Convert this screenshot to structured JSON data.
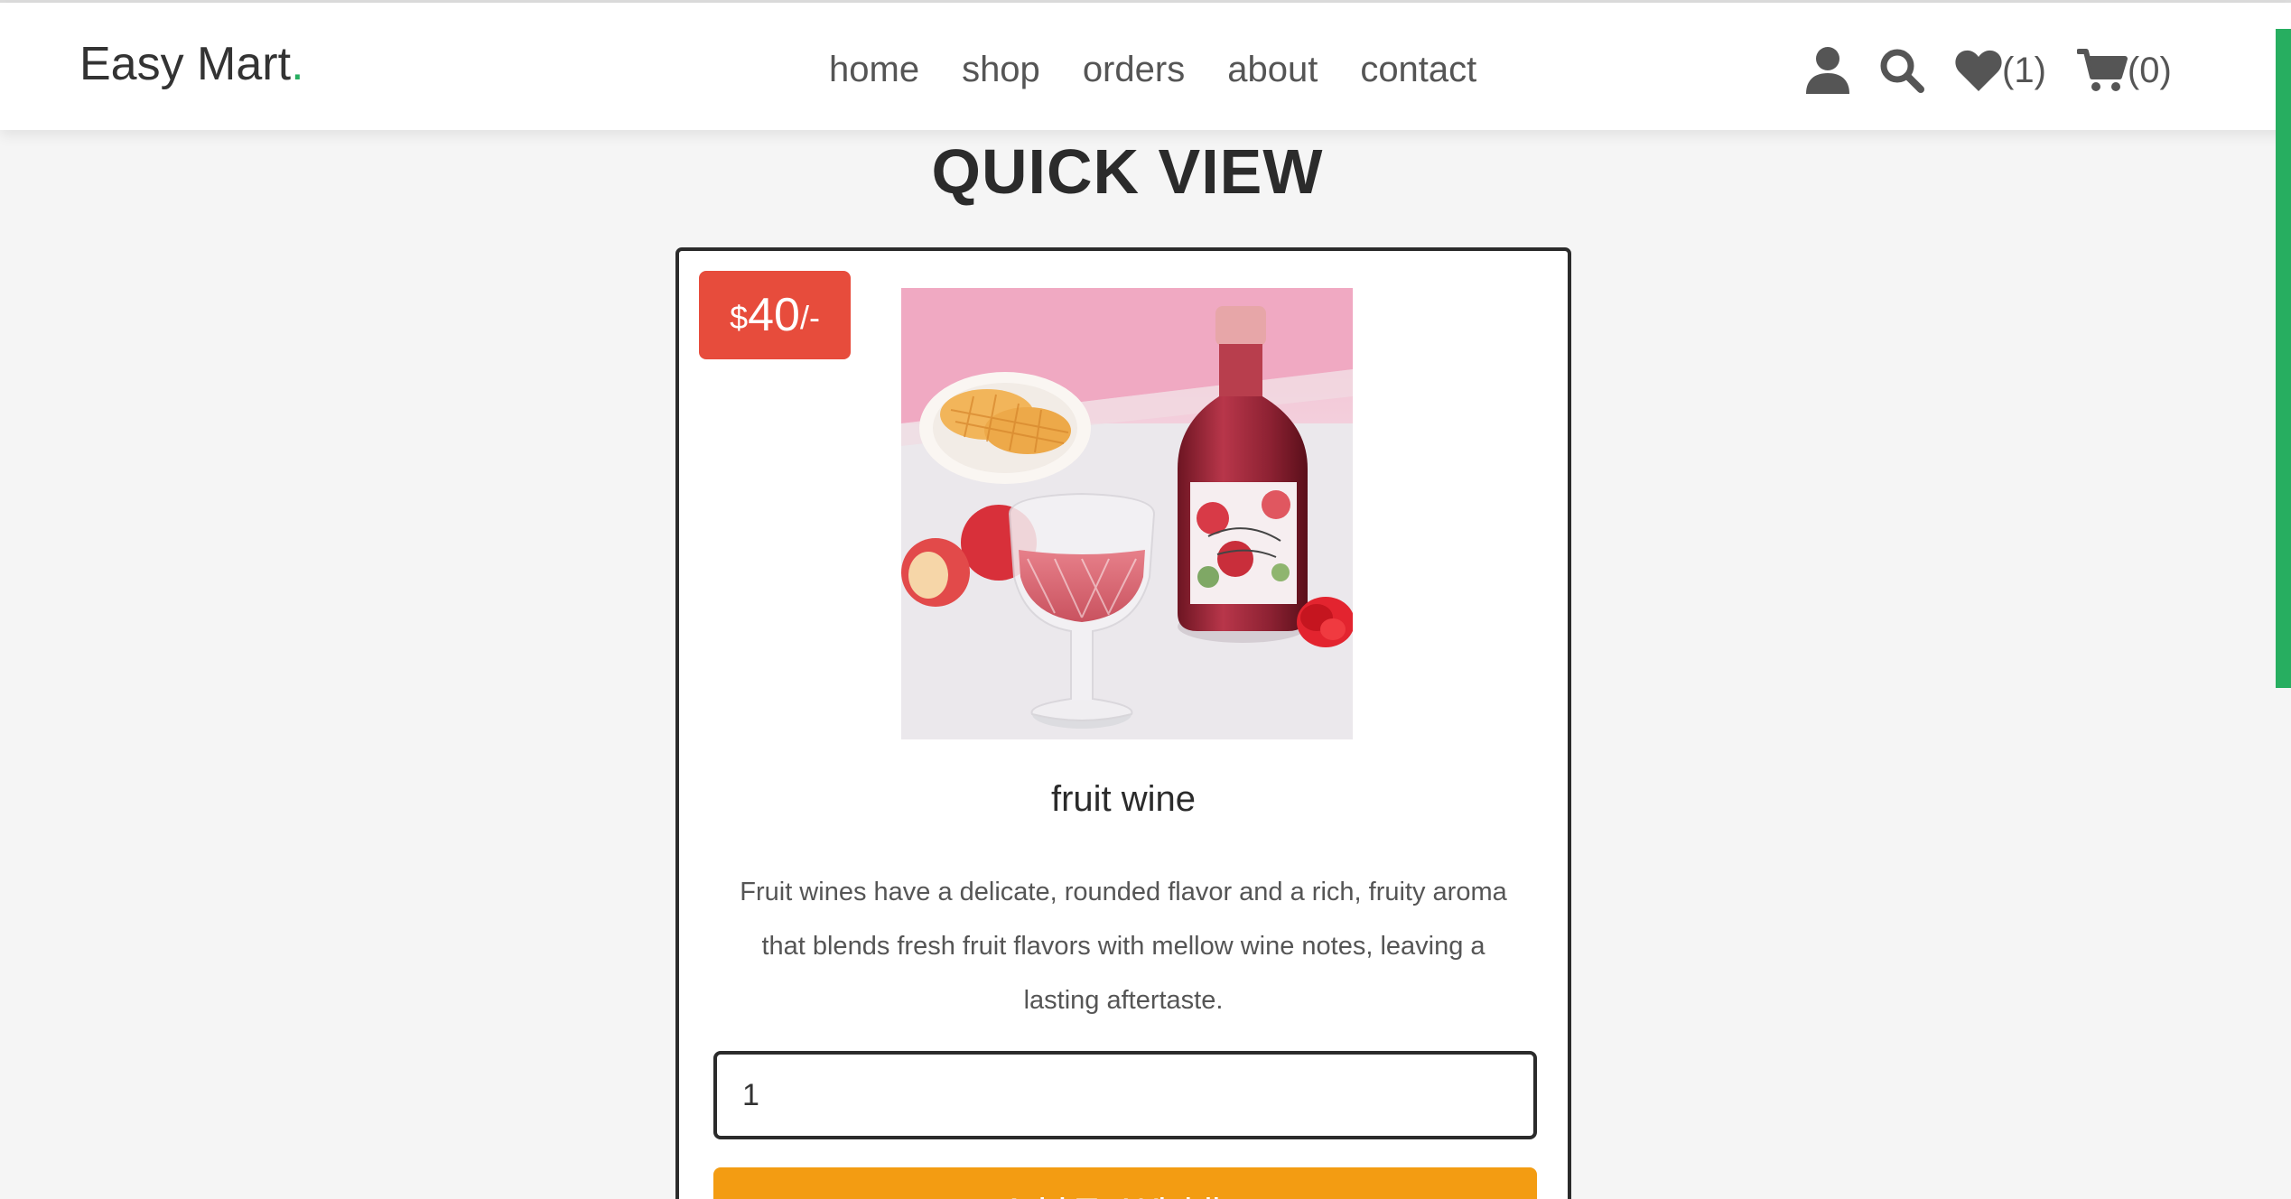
{
  "header": {
    "logo_text": "Easy Mart",
    "logo_dot": ".",
    "nav": [
      "home",
      "shop",
      "orders",
      "about",
      "contact"
    ],
    "wishlist_count": "(1)",
    "cart_count": "(0)"
  },
  "section": {
    "title": "QUICK VIEW"
  },
  "product": {
    "price_currency": "$",
    "price_amount": "40",
    "price_suffix": "/-",
    "name": "fruit wine",
    "description": "Fruit wines have a delicate, rounded flavor and a rich, fruity aroma that blends fresh fruit flavors with mellow wine notes, leaving a lasting aftertaste.",
    "quantity": "1",
    "add_button_label": "Add To Wishlist"
  },
  "colors": {
    "accent": "#27ae60",
    "price_badge": "#e74c3c",
    "button": "#f39c12",
    "text_dark": "#2b2b2b"
  },
  "icons": [
    "user-icon",
    "search-icon",
    "heart-icon",
    "cart-icon"
  ]
}
